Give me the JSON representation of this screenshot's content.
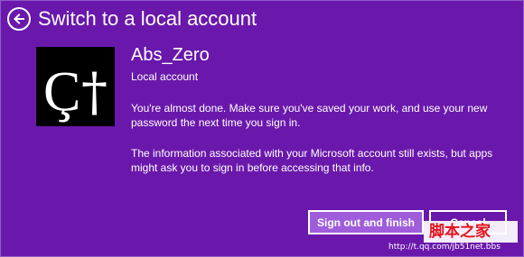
{
  "header": {
    "title": "Switch to a local account",
    "back_icon": "back-arrow-icon"
  },
  "account": {
    "username": "Abs_Zero",
    "type": "Local account"
  },
  "messages": {
    "line1": "You're almost done. Make sure you've saved your work, and use your new password the next time you sign in.",
    "line2": "The information associated with your Microsoft account still exists, but apps might ask you to sign in before accessing that info."
  },
  "buttons": {
    "primary": "Sign out and finish",
    "secondary": "Cancel"
  },
  "watermark": {
    "site_name": "脚本之家",
    "url": "http://t.qq.com/jb51net.bbs"
  },
  "colors": {
    "background": "#6a18ac",
    "primary_button": "#9f5ddb",
    "text": "#ffffff"
  }
}
